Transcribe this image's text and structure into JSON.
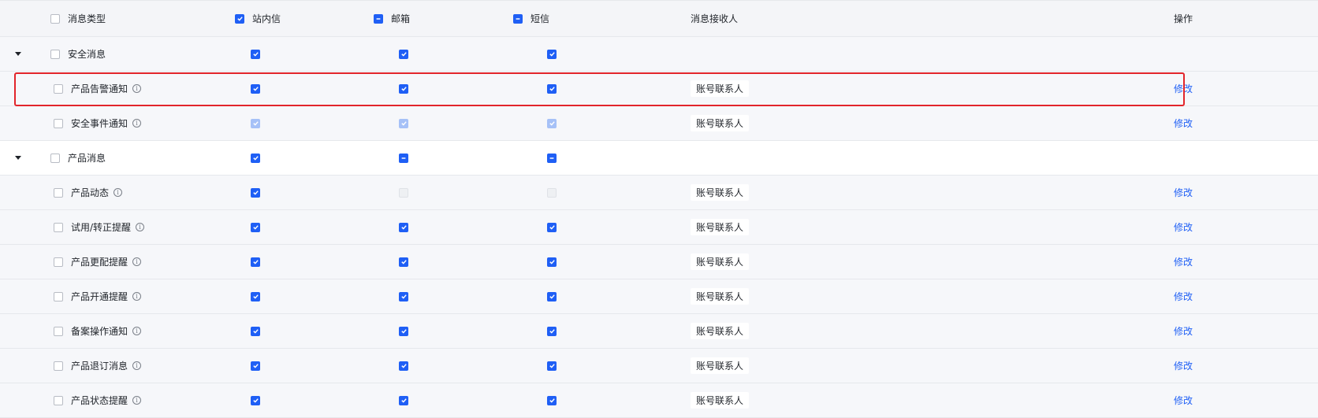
{
  "header": {
    "type": "消息类型",
    "site": "站内信",
    "email": "邮箱",
    "sms": "短信",
    "receiver": "消息接收人",
    "action": "操作"
  },
  "groups": [
    {
      "name": "安全消息",
      "items": [
        {
          "name": "产品告警通知",
          "receiver": "账号联系人",
          "action": "修改"
        },
        {
          "name": "安全事件通知",
          "receiver": "账号联系人",
          "action": "修改"
        }
      ]
    },
    {
      "name": "产品消息",
      "items": [
        {
          "name": "产品动态",
          "receiver": "账号联系人",
          "action": "修改"
        },
        {
          "name": "试用/转正提醒",
          "receiver": "账号联系人",
          "action": "修改"
        },
        {
          "name": "产品更配提醒",
          "receiver": "账号联系人",
          "action": "修改"
        },
        {
          "name": "产品开通提醒",
          "receiver": "账号联系人",
          "action": "修改"
        },
        {
          "name": "备案操作通知",
          "receiver": "账号联系人",
          "action": "修改"
        },
        {
          "name": "产品退订消息",
          "receiver": "账号联系人",
          "action": "修改"
        },
        {
          "name": "产品状态提醒",
          "receiver": "账号联系人",
          "action": "修改"
        }
      ]
    }
  ],
  "colors": {
    "accent": "#1f5ff5",
    "highlight": "#e2252b"
  }
}
